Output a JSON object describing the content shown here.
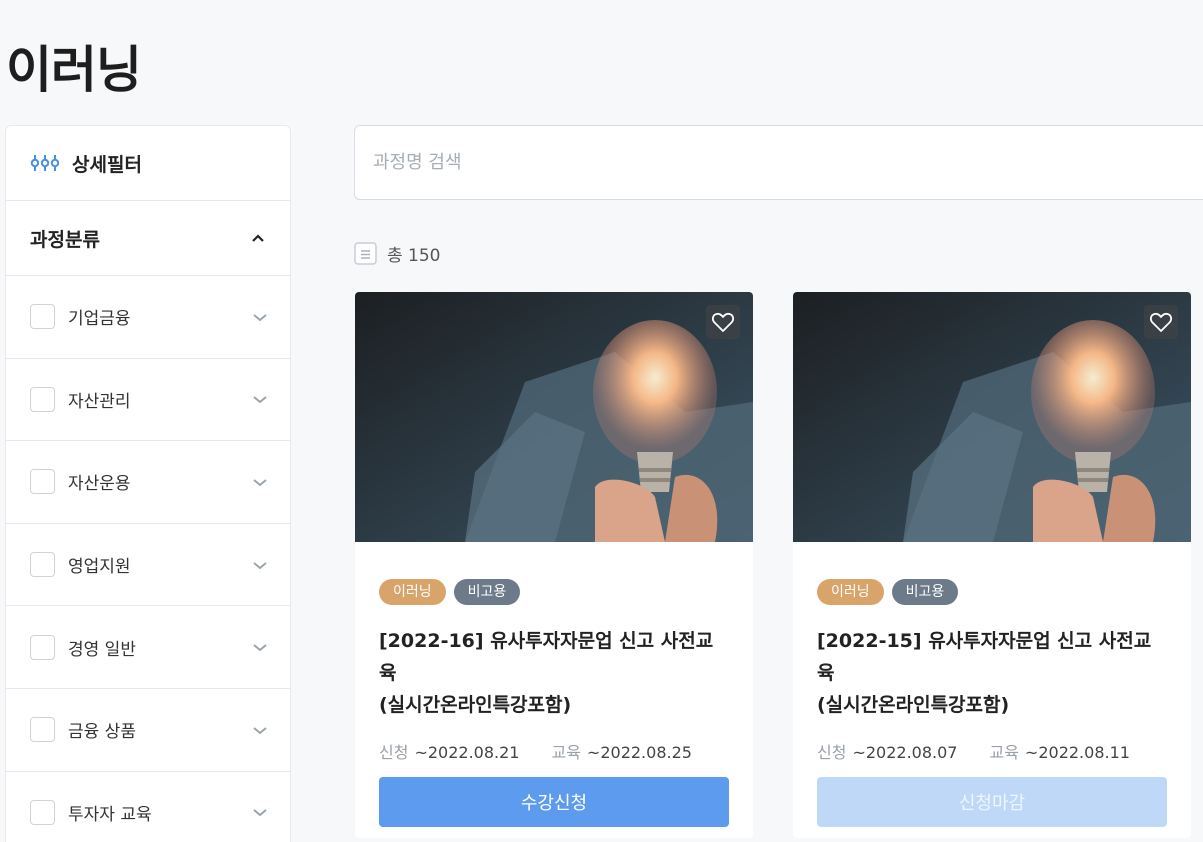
{
  "page": {
    "title": "이러닝"
  },
  "sidebar": {
    "header_label": "상세필터",
    "category_label": "과정분류",
    "items": [
      {
        "label": "기업금융"
      },
      {
        "label": "자산관리"
      },
      {
        "label": "자산운용"
      },
      {
        "label": "영업지원"
      },
      {
        "label": "경영 일반"
      },
      {
        "label": "금융 상품"
      },
      {
        "label": "투자자 교육"
      }
    ]
  },
  "search": {
    "placeholder": "과정명 검색",
    "value": ""
  },
  "summary": {
    "total_text": "총 150"
  },
  "cards": [
    {
      "tags": [
        "이러닝",
        "비고용"
      ],
      "title_line1": "[2022-16] 유사투자자문업 신고 사전교육",
      "title_line2": "(실시간온라인특강포함)",
      "apply_label": "신청",
      "apply_date": "~2022.08.21",
      "edu_label": "교육",
      "edu_date": "~2022.08.25",
      "button_label": "수강신청",
      "button_state": "enabled"
    },
    {
      "tags": [
        "이러닝",
        "비고용"
      ],
      "title_line1": "[2022-15] 유사투자자문업 신고 사전교육",
      "title_line2": "(실시간온라인특강포함)",
      "apply_label": "신청",
      "apply_date": "~2022.08.07",
      "edu_label": "교육",
      "edu_date": "~2022.08.11",
      "button_label": "신청마감",
      "button_state": "disabled"
    }
  ],
  "icons": {
    "filter": "sliders-icon",
    "category_toggle": "chevron-up-icon",
    "item_toggle": "chevron-down-icon",
    "total": "list-icon",
    "favorite": "heart-icon"
  },
  "colors": {
    "primary_button": "#5d9bef",
    "disabled_button": "#c0d8f8",
    "tag_elearning": "#d8a46a",
    "tag_type": "#6c7a8a"
  }
}
